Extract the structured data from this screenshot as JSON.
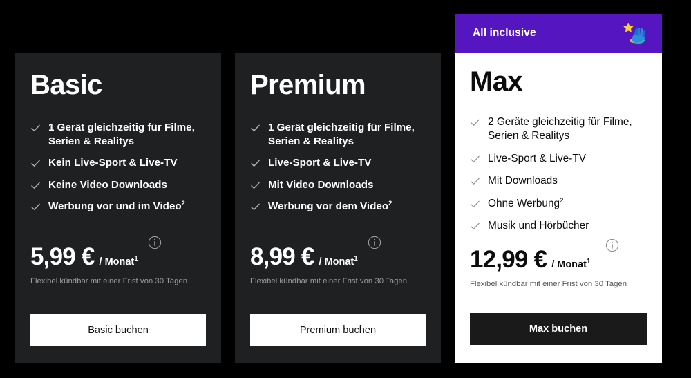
{
  "page": {
    "background_color": "#000000"
  },
  "plans": [
    {
      "id": "basic",
      "title": "Basic",
      "theme": "dark",
      "card_background": "#1f2022",
      "ribbon": null,
      "features": [
        {
          "text": "1 Gerät gleichzeitig für Filme, Serien & Realitys",
          "footnote": ""
        },
        {
          "text": "Kein Live-Sport & Live-TV",
          "footnote": ""
        },
        {
          "text": "Keine Video Downloads",
          "footnote": ""
        },
        {
          "text": "Werbung vor und im Video",
          "footnote": "2"
        }
      ],
      "price": {
        "amount": "5,99 €",
        "period": "/ Monat",
        "period_footnote": "1",
        "info_icon": "info-icon"
      },
      "cancel_note": "Flexibel kündbar mit einer Frist von 30 Tagen",
      "cta_label": "Basic buchen"
    },
    {
      "id": "premium",
      "title": "Premium",
      "theme": "dark",
      "card_background": "#1f2022",
      "ribbon": null,
      "features": [
        {
          "text": "1 Gerät gleichzeitig für Filme, Serien & Realitys",
          "footnote": ""
        },
        {
          "text": "Live-Sport & Live-TV",
          "footnote": ""
        },
        {
          "text": "Mit Video Downloads",
          "footnote": ""
        },
        {
          "text": "Werbung vor dem Video",
          "footnote": "2"
        }
      ],
      "price": {
        "amount": "8,99 €",
        "period": "/ Monat",
        "period_footnote": "1",
        "info_icon": "info-icon"
      },
      "cancel_note": "Flexibel kündbar mit einer Frist von 30 Tagen",
      "cta_label": "Premium buchen"
    },
    {
      "id": "max",
      "title": "Max",
      "theme": "light",
      "card_background": "#ffffff",
      "ribbon": {
        "label": "All inclusive",
        "background_color": "#5515c0",
        "icon": "magic-hand-star-icon"
      },
      "features": [
        {
          "text": "2 Geräte gleichzeitig für Filme, Serien & Realitys",
          "footnote": ""
        },
        {
          "text": "Live-Sport & Live-TV",
          "footnote": ""
        },
        {
          "text": "Mit Downloads",
          "footnote": ""
        },
        {
          "text": "Ohne Werbung",
          "footnote": "2"
        },
        {
          "text": "Musik und Hörbücher",
          "footnote": ""
        }
      ],
      "price": {
        "amount": "12,99 €",
        "period": "/ Monat",
        "period_footnote": "1",
        "info_icon": "info-icon"
      },
      "cancel_note": "Flexibel kündbar mit einer Frist von 30 Tagen",
      "cta_label": "Max buchen"
    }
  ],
  "icons": {
    "check": "check-icon",
    "info": "info-icon"
  }
}
